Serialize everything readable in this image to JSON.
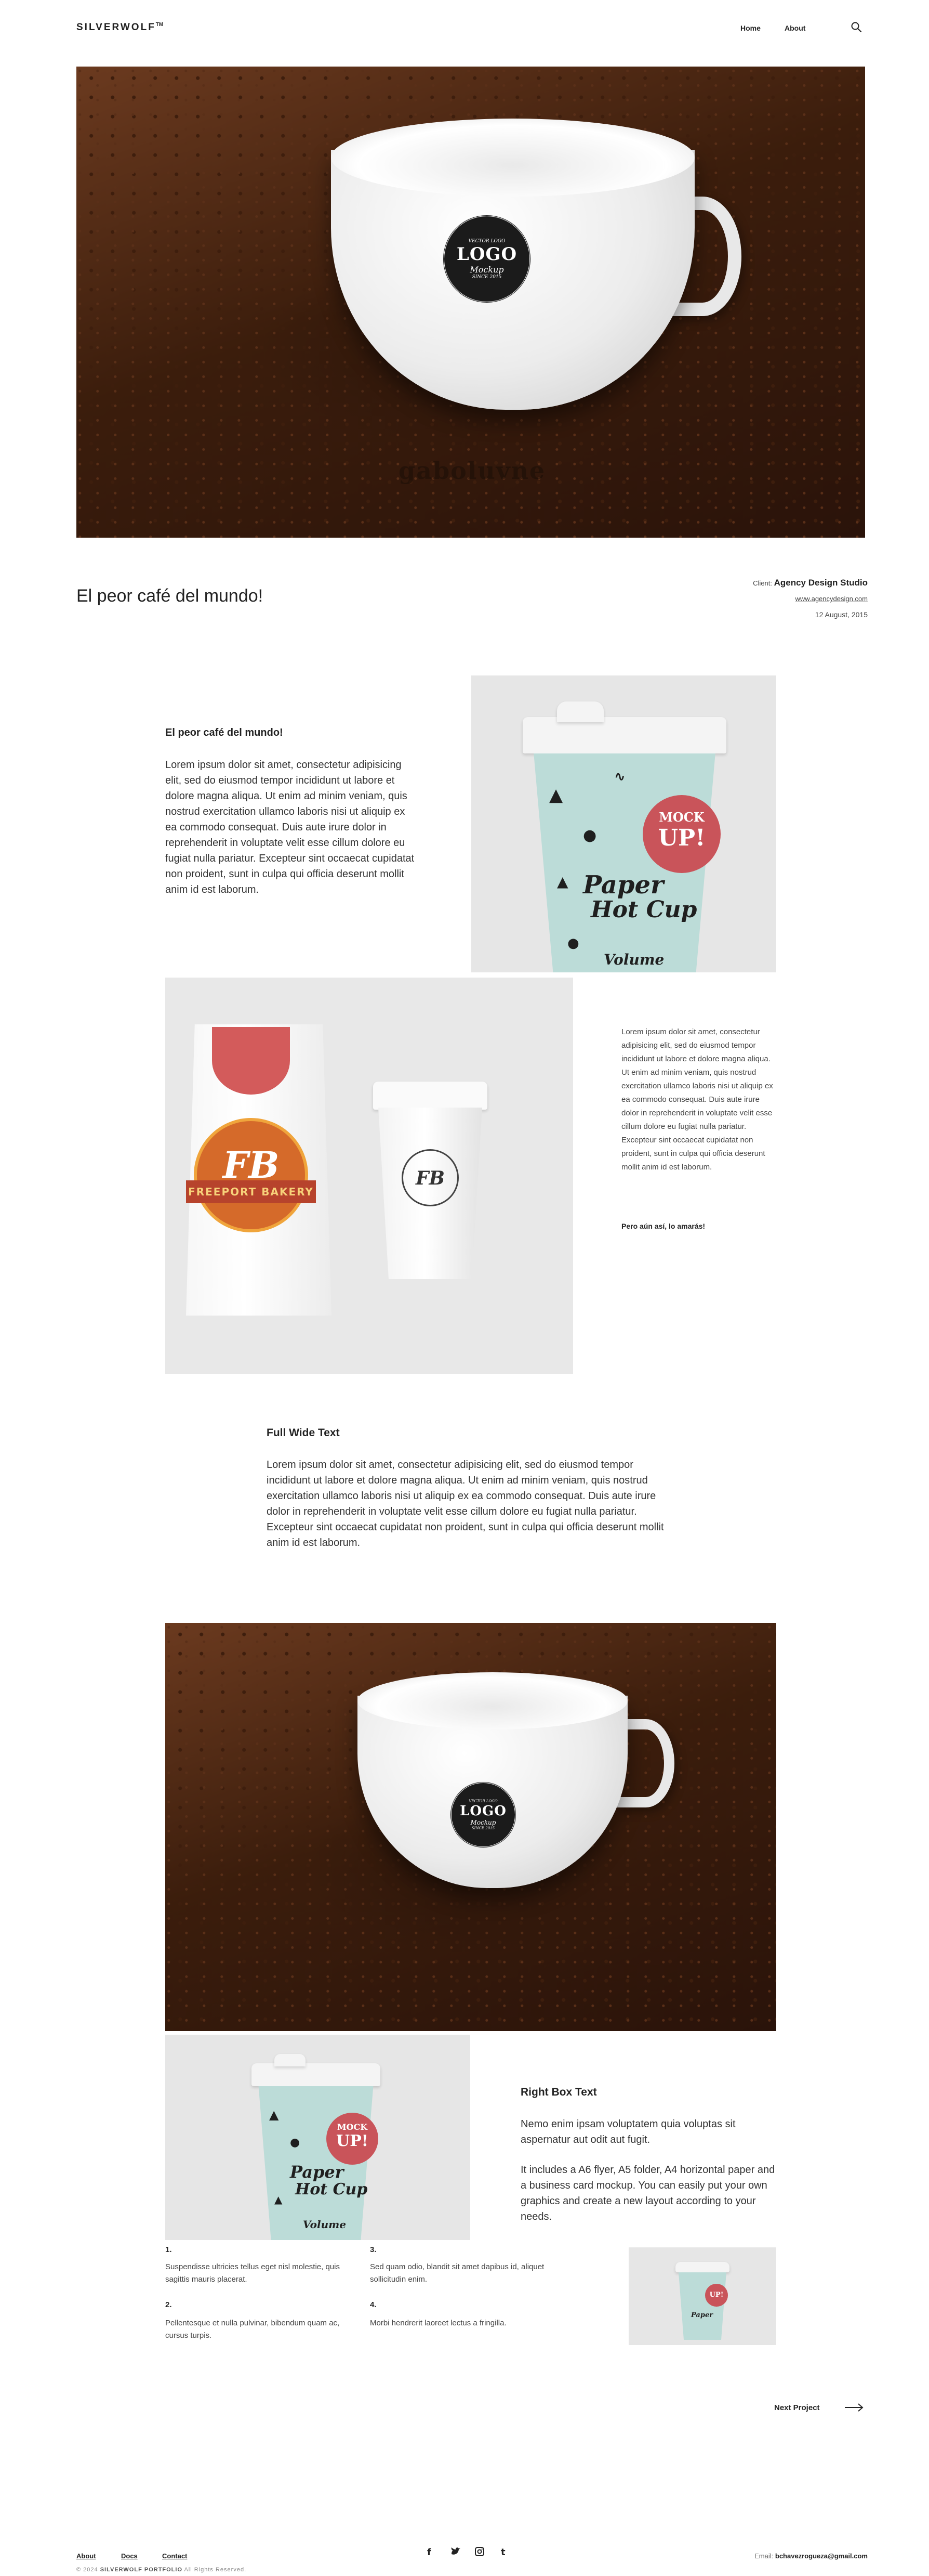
{
  "header": {
    "brand": "SILVERWOLF",
    "brand_mark": "TM",
    "nav": [
      "Home",
      "About"
    ],
    "search_icon": "search-icon"
  },
  "hero": {
    "badge_top": "VECTOR LOGO",
    "badge_main": "LOGO",
    "badge_sub": "Mockup",
    "badge_bottom": "SINCE 2015",
    "watermark": "gaboluvne"
  },
  "project": {
    "title": "El peor café del mundo!",
    "client_label": "Client:",
    "client_name": "Agency Design Studio",
    "url": "www.agencydesign.com",
    "date": "12 August, 2015"
  },
  "block1": {
    "heading": "El peor café del mundo!",
    "text": "Lorem ipsum dolor sit amet, consectetur adipisicing elit, sed do eiusmod tempor incididunt ut labore et dolore magna aliqua. Ut enim ad minim veniam, quis nostrud exercitation ullamco laboris nisi ut aliquip ex ea commodo consequat. Duis aute irure dolor in reprehenderit in voluptate velit esse cillum dolore eu fugiat nulla pariatur. Excepteur sint occaecat cupidatat non proident, sunt in culpa qui officia deserunt mollit anim id est laborum."
  },
  "papercup": {
    "bubble_1": "MOCK",
    "bubble_2": "UP!",
    "script_1": "Paper",
    "script_2": "Hot Cup",
    "footer": "Volume"
  },
  "bakery": {
    "ribbon": "FREEPORT BAKERY",
    "monogram": "FB"
  },
  "block2": {
    "text": "Lorem ipsum dolor sit amet, consectetur adipisicing elit, sed do eiusmod tempor incididunt ut labore et dolore magna aliqua. Ut enim ad minim veniam, quis nostrud exercitation ullamco laboris nisi ut aliquip ex ea commodo consequat. Duis aute irure dolor in reprehenderit in voluptate velit esse cillum dolore eu fugiat nulla pariatur. Excepteur sint occaecat cupidatat non proident, sunt in culpa qui officia deserunt mollit anim id est laborum.",
    "tagline": "Pero aún así, lo amarás!"
  },
  "fullwide": {
    "heading": "Full Wide Text",
    "text": "Lorem ipsum dolor sit amet, consectetur adipisicing elit, sed do eiusmod tempor incididunt ut labore et dolore magna aliqua. Ut enim ad minim veniam, quis nostrud exercitation ullamco laboris nisi ut aliquip ex ea commodo consequat. Duis aute irure dolor in reprehenderit in voluptate velit esse cillum dolore eu fugiat nulla pariatur. Excepteur sint occaecat cupidatat non proident, sunt in culpa qui officia deserunt mollit anim id est laborum."
  },
  "rightbox": {
    "heading": "Right Box Text",
    "para1": "Nemo enim ipsam voluptatem quia voluptas sit aspernatur aut odit aut fugit.",
    "para2": "It includes a A6 flyer, A5 folder, A4 horizontal paper and a business card mockup. You can easily put your own graphics and create a new layout according to your needs."
  },
  "list": [
    {
      "num": "1.",
      "text": "Suspendisse ultricies tellus eget nisl molestie, quis sagittis mauris placerat."
    },
    {
      "num": "2.",
      "text": "Pellentesque et nulla pulvinar, bibendum quam ac, cursus turpis."
    },
    {
      "num": "3.",
      "text": "Sed quam odio, blandit sit amet dapibus id, aliquet sollicitudin enim."
    },
    {
      "num": "4.",
      "text": "Morbi hendrerit laoreet lectus a fringilla."
    }
  ],
  "next_project": "Next Project",
  "footer": {
    "links": [
      "About",
      "Docs",
      "Contact"
    ],
    "copyright_prefix": "© 2024",
    "copyright_brand": "SILVERWOLF PORTFOLIO",
    "copyright_suffix": "All Rights Reserved.",
    "social": [
      "f",
      "t",
      "ig",
      "t"
    ],
    "email_label": "Email:",
    "email": "bchavezrogueza@gmail.com"
  }
}
